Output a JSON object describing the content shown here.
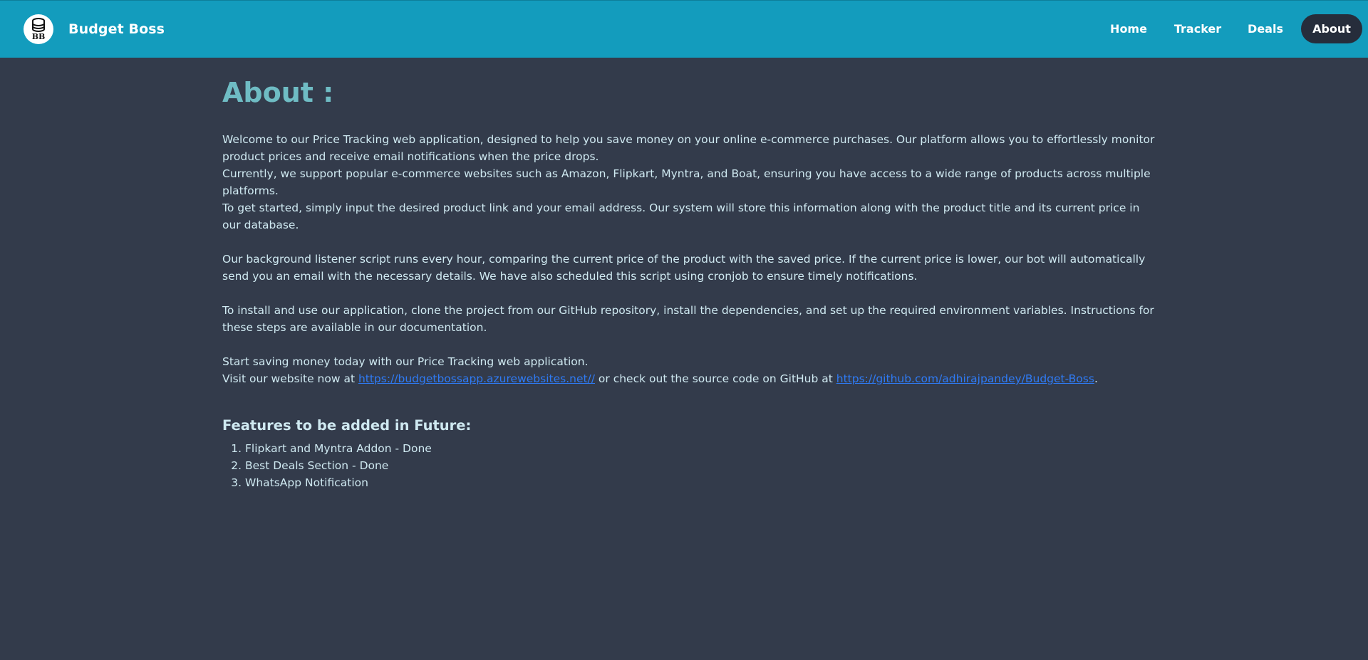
{
  "navbar": {
    "brand_name": "Budget Boss",
    "logo_text": "BB",
    "links": [
      {
        "label": "Home"
      },
      {
        "label": "Tracker"
      },
      {
        "label": "Deals"
      },
      {
        "label": "About",
        "active": true
      }
    ]
  },
  "main": {
    "title": "About :",
    "paragraph1_line1": "Welcome to our Price Tracking web application, designed to help you save money on your online e-commerce purchases. Our platform allows you to effortlessly monitor product prices and receive email notifications when the price drops.",
    "paragraph1_line2": "Currently, we support popular e-commerce websites such as Amazon, Flipkart, Myntra, and Boat, ensuring you have access to a wide range of products across multiple platforms.",
    "paragraph1_line3": "To get started, simply input the desired product link and your email address. Our system will store this information along with the product title and its current price in our database.",
    "paragraph2": "Our background listener script runs every hour, comparing the current price of the product with the saved price. If the current price is lower, our bot will automatically send you an email with the necessary details. We have also scheduled this script using cronjob to ensure timely notifications.",
    "paragraph3": "To install and use our application, clone the project from our GitHub repository, install the dependencies, and set up the required environment variables. Instructions for these steps are available in our documentation.",
    "paragraph4_line1": "Start saving money today with our Price Tracking web application.",
    "paragraph4_prefix": "Visit our website now at ",
    "website_link": "https://budgetbossapp.azurewebsites.net//",
    "paragraph4_middle": " or check out the source code on GitHub at ",
    "github_link": "https://github.com/adhirajpandey/Budget-Boss",
    "paragraph4_suffix": ".",
    "features_title": "Features to be added in Future:",
    "features": [
      "Flipkart and Myntra Addon - Done",
      "Best Deals Section - Done",
      "WhatsApp Notification"
    ]
  },
  "colors": {
    "navbar_bg": "#139cbd",
    "page_bg": "#333b4b",
    "active_nav_bg": "#262d3b",
    "title_color": "#6fbcc4",
    "text_color": "#cfe9f1",
    "link_color": "#2f7bf5"
  },
  "icons": {
    "logo": "database-stack-icon"
  }
}
